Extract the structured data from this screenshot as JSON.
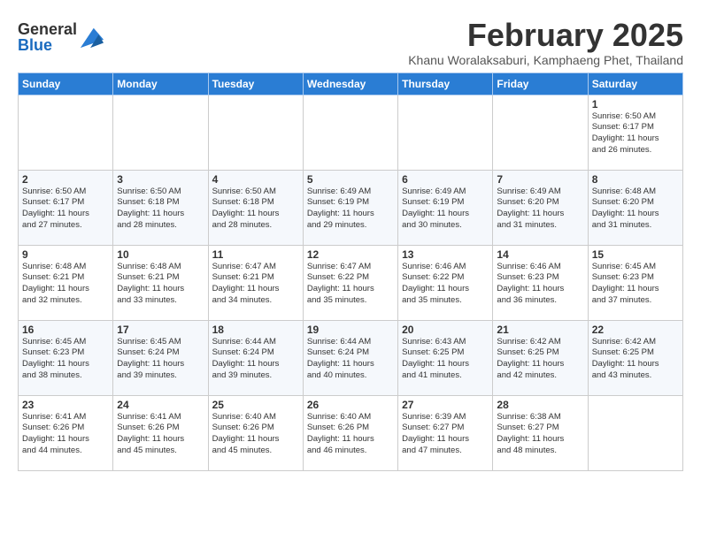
{
  "header": {
    "logo_general": "General",
    "logo_blue": "Blue",
    "month_title": "February 2025",
    "subtitle": "Khanu Woralaksaburi, Kamphaeng Phet, Thailand"
  },
  "weekdays": [
    "Sunday",
    "Monday",
    "Tuesday",
    "Wednesday",
    "Thursday",
    "Friday",
    "Saturday"
  ],
  "weeks": [
    [
      {
        "day": "",
        "info": ""
      },
      {
        "day": "",
        "info": ""
      },
      {
        "day": "",
        "info": ""
      },
      {
        "day": "",
        "info": ""
      },
      {
        "day": "",
        "info": ""
      },
      {
        "day": "",
        "info": ""
      },
      {
        "day": "1",
        "info": "Sunrise: 6:50 AM\nSunset: 6:17 PM\nDaylight: 11 hours\nand 26 minutes."
      }
    ],
    [
      {
        "day": "2",
        "info": "Sunrise: 6:50 AM\nSunset: 6:17 PM\nDaylight: 11 hours\nand 27 minutes."
      },
      {
        "day": "3",
        "info": "Sunrise: 6:50 AM\nSunset: 6:18 PM\nDaylight: 11 hours\nand 28 minutes."
      },
      {
        "day": "4",
        "info": "Sunrise: 6:50 AM\nSunset: 6:18 PM\nDaylight: 11 hours\nand 28 minutes."
      },
      {
        "day": "5",
        "info": "Sunrise: 6:49 AM\nSunset: 6:19 PM\nDaylight: 11 hours\nand 29 minutes."
      },
      {
        "day": "6",
        "info": "Sunrise: 6:49 AM\nSunset: 6:19 PM\nDaylight: 11 hours\nand 30 minutes."
      },
      {
        "day": "7",
        "info": "Sunrise: 6:49 AM\nSunset: 6:20 PM\nDaylight: 11 hours\nand 31 minutes."
      },
      {
        "day": "8",
        "info": "Sunrise: 6:48 AM\nSunset: 6:20 PM\nDaylight: 11 hours\nand 31 minutes."
      }
    ],
    [
      {
        "day": "9",
        "info": "Sunrise: 6:48 AM\nSunset: 6:21 PM\nDaylight: 11 hours\nand 32 minutes."
      },
      {
        "day": "10",
        "info": "Sunrise: 6:48 AM\nSunset: 6:21 PM\nDaylight: 11 hours\nand 33 minutes."
      },
      {
        "day": "11",
        "info": "Sunrise: 6:47 AM\nSunset: 6:21 PM\nDaylight: 11 hours\nand 34 minutes."
      },
      {
        "day": "12",
        "info": "Sunrise: 6:47 AM\nSunset: 6:22 PM\nDaylight: 11 hours\nand 35 minutes."
      },
      {
        "day": "13",
        "info": "Sunrise: 6:46 AM\nSunset: 6:22 PM\nDaylight: 11 hours\nand 35 minutes."
      },
      {
        "day": "14",
        "info": "Sunrise: 6:46 AM\nSunset: 6:23 PM\nDaylight: 11 hours\nand 36 minutes."
      },
      {
        "day": "15",
        "info": "Sunrise: 6:45 AM\nSunset: 6:23 PM\nDaylight: 11 hours\nand 37 minutes."
      }
    ],
    [
      {
        "day": "16",
        "info": "Sunrise: 6:45 AM\nSunset: 6:23 PM\nDaylight: 11 hours\nand 38 minutes."
      },
      {
        "day": "17",
        "info": "Sunrise: 6:45 AM\nSunset: 6:24 PM\nDaylight: 11 hours\nand 39 minutes."
      },
      {
        "day": "18",
        "info": "Sunrise: 6:44 AM\nSunset: 6:24 PM\nDaylight: 11 hours\nand 39 minutes."
      },
      {
        "day": "19",
        "info": "Sunrise: 6:44 AM\nSunset: 6:24 PM\nDaylight: 11 hours\nand 40 minutes."
      },
      {
        "day": "20",
        "info": "Sunrise: 6:43 AM\nSunset: 6:25 PM\nDaylight: 11 hours\nand 41 minutes."
      },
      {
        "day": "21",
        "info": "Sunrise: 6:42 AM\nSunset: 6:25 PM\nDaylight: 11 hours\nand 42 minutes."
      },
      {
        "day": "22",
        "info": "Sunrise: 6:42 AM\nSunset: 6:25 PM\nDaylight: 11 hours\nand 43 minutes."
      }
    ],
    [
      {
        "day": "23",
        "info": "Sunrise: 6:41 AM\nSunset: 6:26 PM\nDaylight: 11 hours\nand 44 minutes."
      },
      {
        "day": "24",
        "info": "Sunrise: 6:41 AM\nSunset: 6:26 PM\nDaylight: 11 hours\nand 45 minutes."
      },
      {
        "day": "25",
        "info": "Sunrise: 6:40 AM\nSunset: 6:26 PM\nDaylight: 11 hours\nand 45 minutes."
      },
      {
        "day": "26",
        "info": "Sunrise: 6:40 AM\nSunset: 6:26 PM\nDaylight: 11 hours\nand 46 minutes."
      },
      {
        "day": "27",
        "info": "Sunrise: 6:39 AM\nSunset: 6:27 PM\nDaylight: 11 hours\nand 47 minutes."
      },
      {
        "day": "28",
        "info": "Sunrise: 6:38 AM\nSunset: 6:27 PM\nDaylight: 11 hours\nand 48 minutes."
      },
      {
        "day": "",
        "info": ""
      }
    ]
  ]
}
